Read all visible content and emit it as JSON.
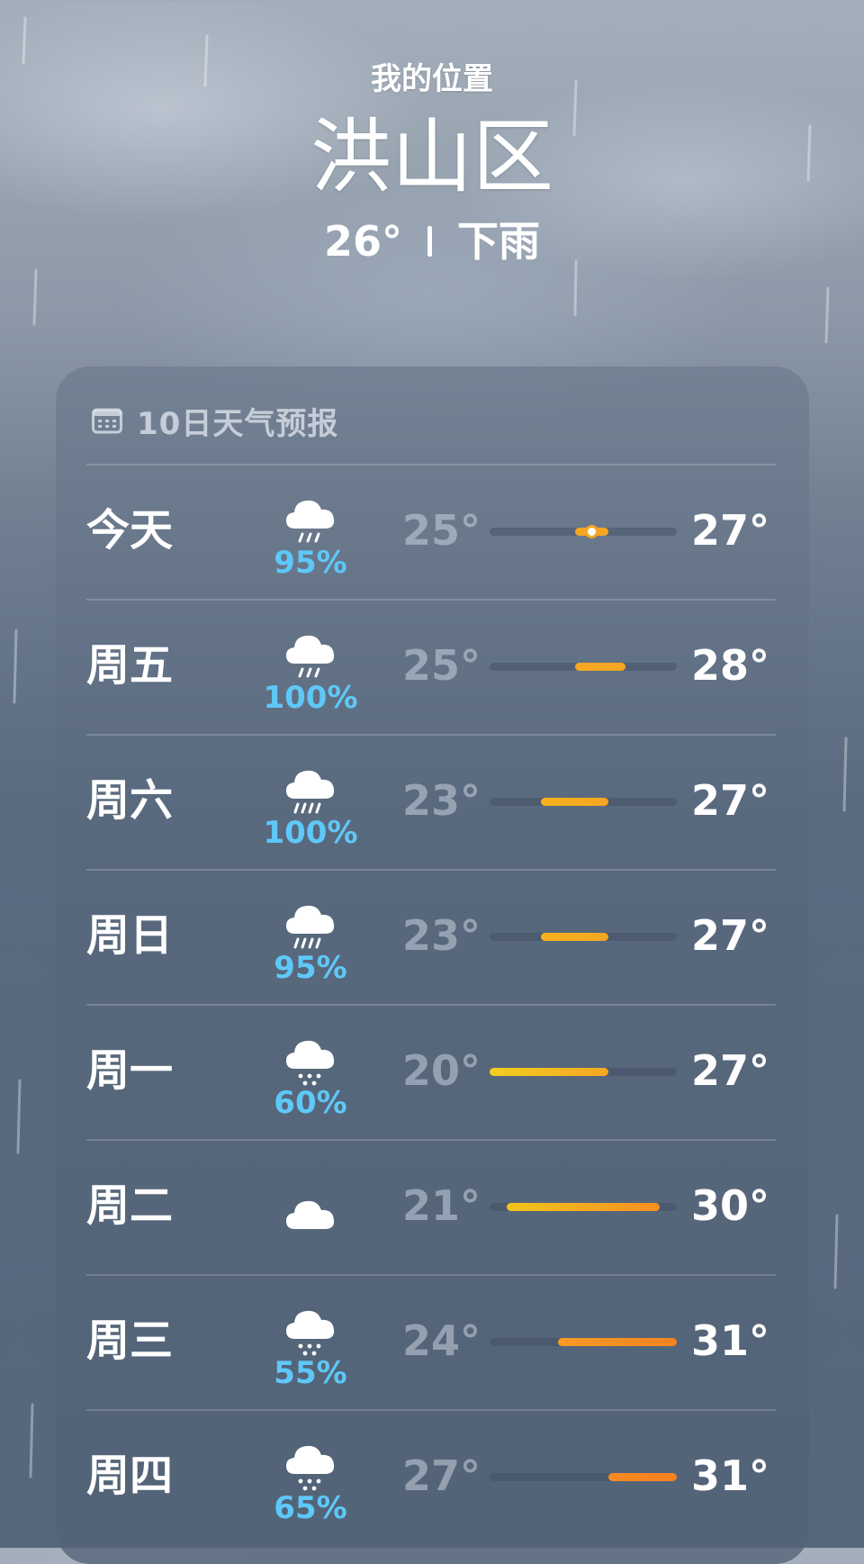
{
  "header": {
    "location_label": "我的位置",
    "city": "洪山区",
    "temp": "26°",
    "condition": "下雨"
  },
  "forecast": {
    "title": "10日天气预报",
    "calendar_icon": "calendar-icon",
    "range_min": 20,
    "range_max": 31,
    "days": [
      {
        "day": "今天",
        "icon": "cloud-rain-icon",
        "precip": "95%",
        "low": "25°",
        "high": "27°",
        "low_val": 25,
        "high_val": 27,
        "current_val": 26,
        "colors": [
          "#f5a623",
          "#f5a623"
        ]
      },
      {
        "day": "周五",
        "icon": "cloud-rain-icon",
        "precip": "100%",
        "low": "25°",
        "high": "28°",
        "low_val": 25,
        "high_val": 28,
        "colors": [
          "#f5a623",
          "#f5a623"
        ]
      },
      {
        "day": "周六",
        "icon": "cloud-heavy-rain-icon",
        "precip": "100%",
        "low": "23°",
        "high": "27°",
        "low_val": 23,
        "high_val": 27,
        "colors": [
          "#f6b21c",
          "#f5a623"
        ]
      },
      {
        "day": "周日",
        "icon": "cloud-heavy-rain-icon",
        "precip": "95%",
        "low": "23°",
        "high": "27°",
        "low_val": 23,
        "high_val": 27,
        "colors": [
          "#f6b21c",
          "#f5a623"
        ]
      },
      {
        "day": "周一",
        "icon": "cloud-drizzle-icon",
        "precip": "60%",
        "low": "20°",
        "high": "27°",
        "low_val": 20,
        "high_val": 27,
        "colors": [
          "#f3cf1f",
          "#f5a623"
        ]
      },
      {
        "day": "周二",
        "icon": "cloud-icon",
        "precip": "",
        "low": "21°",
        "high": "30°",
        "low_val": 21,
        "high_val": 30,
        "colors": [
          "#f2c51c",
          "#f58f23"
        ]
      },
      {
        "day": "周三",
        "icon": "cloud-drizzle-icon",
        "precip": "55%",
        "low": "24°",
        "high": "31°",
        "low_val": 24,
        "high_val": 31,
        "colors": [
          "#f79a24",
          "#f58320"
        ]
      },
      {
        "day": "周四",
        "icon": "cloud-drizzle-icon",
        "precip": "65%",
        "low": "27°",
        "high": "31°",
        "low_val": 27,
        "high_val": 31,
        "colors": [
          "#f58a22",
          "#f5801f"
        ]
      }
    ]
  }
}
